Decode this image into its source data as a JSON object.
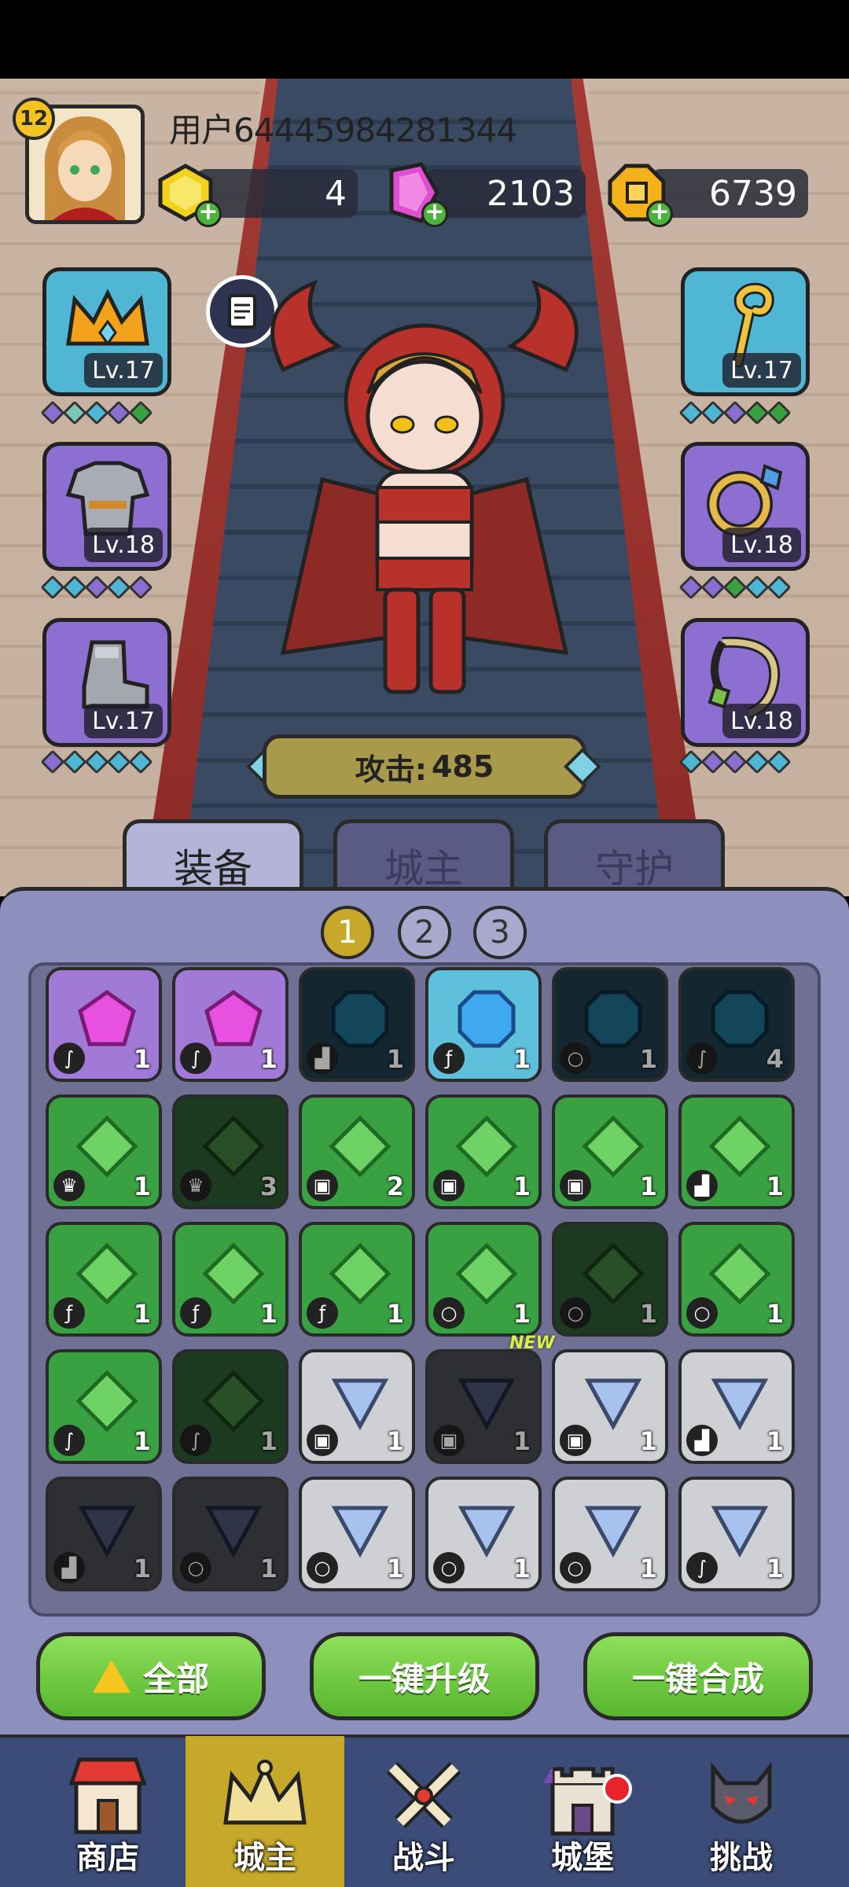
{
  "player": {
    "level": "12",
    "username": "用户64445984281344"
  },
  "currencies": [
    {
      "name": "yellow-gem",
      "value": "4",
      "color": "#f2d21f"
    },
    {
      "name": "pink-crystal",
      "value": "2103",
      "color": "#e04fd1"
    },
    {
      "name": "gold-coin",
      "value": "6739",
      "color": "#f4b21a"
    }
  ],
  "equipment": {
    "left": [
      {
        "item": "crown",
        "level": "Lv.17",
        "rarity": "blue"
      },
      {
        "item": "armor",
        "level": "Lv.18",
        "rarity": "purple"
      },
      {
        "item": "boots",
        "level": "Lv.17",
        "rarity": "purple"
      }
    ],
    "right": [
      {
        "item": "staff",
        "level": "Lv.17",
        "rarity": "blue"
      },
      {
        "item": "ring",
        "level": "Lv.18",
        "rarity": "purple"
      },
      {
        "item": "amulet",
        "level": "Lv.18",
        "rarity": "purple"
      }
    ]
  },
  "attack": {
    "label": "攻击:",
    "value": "485"
  },
  "tabs": [
    "装备",
    "城主",
    "守护"
  ],
  "pages": [
    "1",
    "2",
    "3"
  ],
  "inventory": [
    [
      {
        "c": "purple",
        "n": "1",
        "t": "amulet"
      },
      {
        "c": "purple",
        "n": "1",
        "t": "amulet"
      },
      {
        "c": "darkteal",
        "n": "1",
        "t": "boots"
      },
      {
        "c": "cyan",
        "n": "1",
        "t": "staff"
      },
      {
        "c": "darkteal",
        "n": "1",
        "t": "ring"
      },
      {
        "c": "darkteal",
        "n": "4",
        "t": "amulet"
      }
    ],
    [
      {
        "c": "green",
        "n": "1",
        "t": "crown"
      },
      {
        "c": "dgreen",
        "n": "3",
        "t": "crown"
      },
      {
        "c": "green",
        "n": "2",
        "t": "armor"
      },
      {
        "c": "green",
        "n": "1",
        "t": "armor"
      },
      {
        "c": "green",
        "n": "1",
        "t": "armor"
      },
      {
        "c": "green",
        "n": "1",
        "t": "boots"
      }
    ],
    [
      {
        "c": "green",
        "n": "1",
        "t": "staff"
      },
      {
        "c": "green",
        "n": "1",
        "t": "staff"
      },
      {
        "c": "green",
        "n": "1",
        "t": "staff"
      },
      {
        "c": "green",
        "n": "1",
        "t": "ring"
      },
      {
        "c": "dgreen",
        "n": "1",
        "t": "ring"
      },
      {
        "c": "green",
        "n": "1",
        "t": "ring"
      }
    ],
    [
      {
        "c": "green",
        "n": "1",
        "t": "amulet"
      },
      {
        "c": "dgreen",
        "n": "1",
        "t": "amulet"
      },
      {
        "c": "grey",
        "n": "1",
        "t": "armor"
      },
      {
        "c": "dgrey",
        "n": "1",
        "t": "armor"
      },
      {
        "c": "grey",
        "n": "1",
        "t": "armor"
      },
      {
        "c": "grey",
        "n": "1",
        "t": "boots"
      }
    ],
    [
      {
        "c": "dgrey",
        "n": "1",
        "t": "boots"
      },
      {
        "c": "dgrey",
        "n": "1",
        "t": "ring"
      },
      {
        "c": "grey",
        "n": "1",
        "t": "ring"
      },
      {
        "c": "grey",
        "n": "1",
        "t": "ring"
      },
      {
        "c": "grey",
        "n": "1",
        "t": "ring"
      },
      {
        "c": "grey",
        "n": "1",
        "t": "amulet"
      }
    ]
  ],
  "new_tag": "NEW",
  "buttons": {
    "all": "全部",
    "upgrade": "一键升级",
    "merge": "一键合成"
  },
  "nav": [
    "商店",
    "城主",
    "战斗",
    "城堡",
    "挑战"
  ]
}
